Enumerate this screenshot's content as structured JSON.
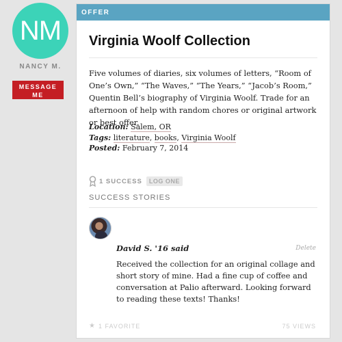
{
  "owner": {
    "initials": "NM",
    "name": "NANCY M.",
    "message_button": "MESSAGE ME",
    "avatar_color": "#3cd3b8"
  },
  "card": {
    "header_label": "OFFER",
    "header_color": "#5aa4c2",
    "title": "Virginia Woolf Collection",
    "description": "Five volumes of diaries, six volumes of letters, “Room of One’s Own,” “The Waves,” “The Years,” “Jacob’s Room,” Quentin Bell’s biography of Virginia Woolf. Trade for an afternoon of help with random chores or original artwork or best offer.",
    "location_label": "Location:",
    "location": "Salem, OR",
    "tags_label": "Tags:",
    "tags": [
      "literature",
      "books",
      "Virginia Woolf"
    ],
    "posted_label": "Posted:",
    "posted": "February 7, 2014"
  },
  "success": {
    "count_label": "1 SUCCESS",
    "log_button": "LOG ONE",
    "stories_heading": "SUCCESS STORIES",
    "stories": [
      {
        "author": "David S. '16 said",
        "delete_label": "Delete",
        "text": "Received the collection for an original collage and short story of mine. Had a fine cup of coffee and conversation at Palio afterward. Looking forward to reading these texts! Thanks!"
      }
    ]
  },
  "footer": {
    "favorites": "1 FAVORITE",
    "views": "75 VIEWS"
  },
  "icons": {
    "ribbon": "award-ribbon-icon",
    "star": "star-icon"
  },
  "accent_colors": {
    "message_button": "#c41e24"
  }
}
